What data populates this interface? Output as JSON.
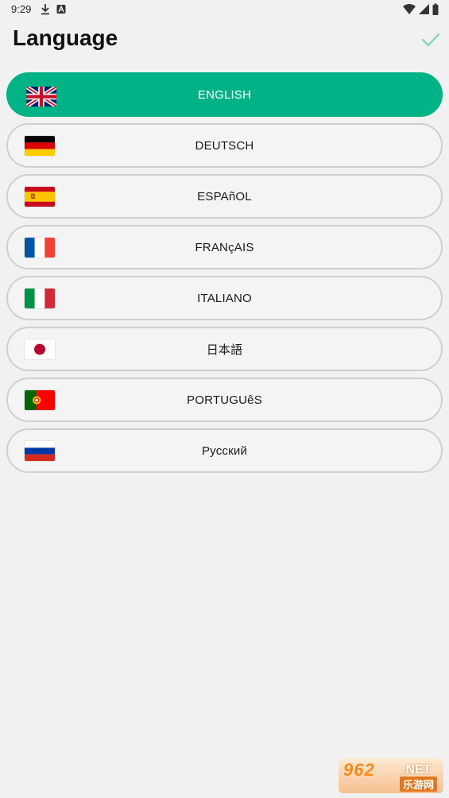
{
  "status_bar": {
    "time": "9:29",
    "icons": [
      "download-icon",
      "a-notification-icon",
      "wifi-icon",
      "signal-icon",
      "battery-icon"
    ]
  },
  "header": {
    "title": "Language",
    "confirm_icon": "check-icon",
    "confirm_color": "#8fd6bd"
  },
  "languages": [
    {
      "label": "ENGLISH",
      "flag": "uk-flag-icon",
      "selected": true
    },
    {
      "label": "DEUTSCH",
      "flag": "germany-flag-icon",
      "selected": false
    },
    {
      "label": "ESPAñOL",
      "flag": "spain-flag-icon",
      "selected": false
    },
    {
      "label": "FRANçAIS",
      "flag": "france-flag-icon",
      "selected": false
    },
    {
      "label": "ITALIANO",
      "flag": "italy-flag-icon",
      "selected": false
    },
    {
      "label": "日本語",
      "flag": "japan-flag-icon",
      "selected": false
    },
    {
      "label": "PORTUGUêS",
      "flag": "portugal-flag-icon",
      "selected": false
    },
    {
      "label": "Русский",
      "flag": "russia-flag-icon",
      "selected": false
    }
  ],
  "colors": {
    "accent": "#00b386",
    "background": "#f1f1f1",
    "item_border": "#cfcfcf"
  },
  "watermark": {
    "top": "962",
    "top_suffix": ".NET",
    "bottom": "乐游网"
  }
}
